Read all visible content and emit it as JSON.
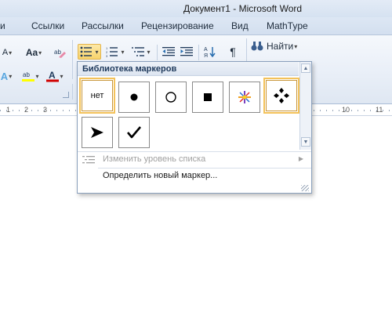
{
  "window": {
    "title": "Документ1  -  Microsoft Word"
  },
  "tabs": [
    "Ссылки",
    "Рассылки",
    "Рецензирование",
    "Вид",
    "MathType"
  ],
  "ribbon": {
    "row1": {
      "font_size_label": "A",
      "change_case_label": "Aa",
      "paragraph_mark": "¶",
      "find_label": "Найти"
    },
    "row2": {
      "text_effect_label": "A",
      "font_color_label": "A"
    },
    "colors": {
      "font_color": "#d00000",
      "highlight": "#ffff00",
      "active_border": "#e3b44c"
    }
  },
  "ruler": {
    "numbers": [
      "1",
      "2",
      "3",
      "10",
      "11"
    ]
  },
  "bullet_gallery": {
    "header": "Библиотека маркеров",
    "none_label": "нет",
    "bullets": [
      "filled-circle",
      "hollow-circle",
      "filled-square",
      "colorful-star",
      "four-diamonds",
      "arrowhead",
      "checkmark"
    ],
    "menu": {
      "change_level": "Изменить уровень списка",
      "define_new": "Определить новый маркер..."
    }
  }
}
